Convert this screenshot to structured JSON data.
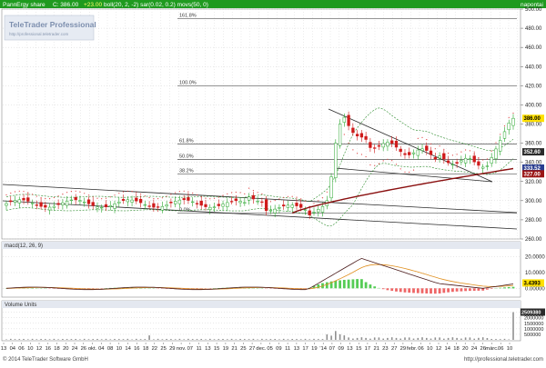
{
  "header": {
    "title": "PannErgy share",
    "close_label": "C: 386.00",
    "change": "+23.00",
    "indicators": "boll(20, 2, -2)  sar(0.02, 0.2)  movs(50, 0)",
    "period": "napontai"
  },
  "watermark": {
    "line1": "TeleTrader Professional",
    "line2": "http://professional.teletrader.com"
  },
  "price_panel": {
    "y_range": [
      260,
      500
    ],
    "y_ticks": [
      260,
      280,
      300,
      320,
      340,
      360,
      380,
      400,
      420,
      440,
      460,
      480,
      500
    ],
    "y_tick_labels": [
      "260.00",
      "280.00",
      "300.00",
      "320.00",
      "340.00",
      "360.00",
      "380.00",
      "400.00",
      "420.00",
      "440.00",
      "460.00",
      "480.00",
      "500.00"
    ],
    "fib_labels": [
      "161.8%",
      "100.0%",
      "61.8%",
      "50.0%",
      "38.2%",
      "0.0%"
    ],
    "fib_values": [
      490,
      420,
      359,
      343,
      328,
      287
    ],
    "price_tags": [
      {
        "text": "386.00",
        "value": 386,
        "bg": "#ffe000",
        "fg": "#000000"
      },
      {
        "text": "352.60",
        "value": 351,
        "bg": "#2b2b2b",
        "fg": "#ffffff"
      },
      {
        "text": "333.52",
        "value": 334,
        "bg": "#2a3d8f",
        "fg": "#ffffff"
      },
      {
        "text": "327.00",
        "value": 328,
        "bg": "#9a1515",
        "fg": "#ffffff"
      }
    ]
  },
  "macd_panel": {
    "title": "macd(12, 26, 9)",
    "y_range": [
      -5,
      25
    ],
    "y_ticks": [
      0,
      10,
      20
    ],
    "y_tick_labels": [
      "0.00000",
      "10.0000",
      "20.0000"
    ],
    "value_tag": {
      "text": "3.4393",
      "value": 3.4393
    }
  },
  "volume_panel": {
    "title": "Volume Units",
    "y_range": [
      0,
      280000
    ],
    "y_ticks": [
      50000,
      100000,
      150000,
      200000,
      250000
    ],
    "y_tick_labels": [
      "500000",
      "1000000",
      "1500000",
      "2000000",
      "2500000"
    ],
    "value_tag": {
      "text": "2509380",
      "value": 2509380
    }
  },
  "x_axis": {
    "labels": [
      "13",
      "04",
      "06",
      "10",
      "12",
      "16",
      "18",
      "20",
      "24",
      "26",
      "okt.",
      "04",
      "08",
      "10",
      "14",
      "16",
      "18",
      "22",
      "25",
      "29",
      "nov.",
      "07",
      "11",
      "13",
      "15",
      "19",
      "21",
      "25",
      "27",
      "dec.",
      "05",
      "09",
      "11",
      "13",
      "17",
      "19",
      "'14",
      "07",
      "09",
      "13",
      "15",
      "17",
      "21",
      "23",
      "27",
      "29",
      "febr.",
      "06",
      "10",
      "12",
      "14",
      "18",
      "20",
      "24",
      "26",
      "márc.",
      "06",
      "10"
    ]
  },
  "footer": {
    "copyright": "© 2014 TeleTrader Software GmbH",
    "url": "http://professional.teletrader.com"
  },
  "colors": {
    "up_candle": "#25a52a",
    "down_candle": "#cf1a1a",
    "ma_line": "#8a1010",
    "bollinger": "#2a8a2a",
    "sar": "#e04040",
    "macd_line": "#4a1a1a",
    "signal_line": "#e09020",
    "hist_up": "#55cc55",
    "hist_down": "#ee6666",
    "volume_bar": "#909090",
    "grid": "#d0d0d0",
    "header_bar": "#1f9a1f"
  },
  "chart_data": {
    "type": "candlestick",
    "price_levels": {
      "last_close": 386,
      "moving_average_50": 333.52,
      "sar": 327,
      "reference": 352.6
    },
    "macd_last": 3.4393,
    "volume_last": 2509380
  }
}
